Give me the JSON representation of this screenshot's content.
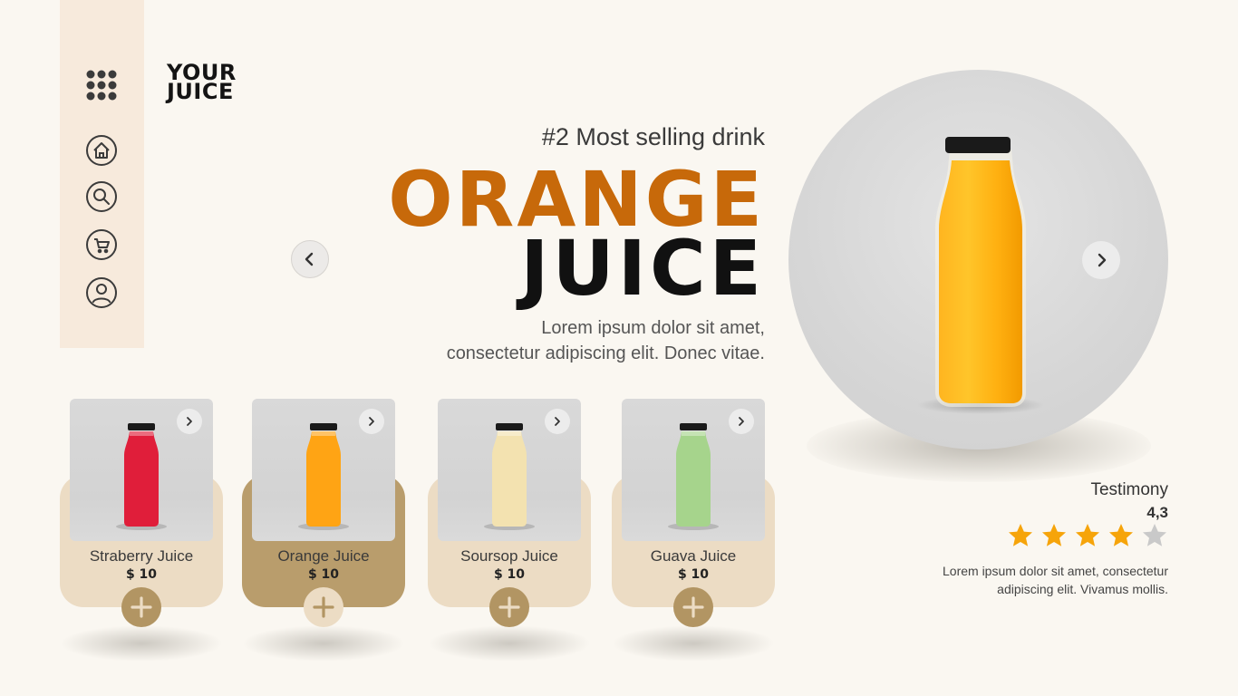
{
  "brand": {
    "line1": "YOUR",
    "line2": "JUICE"
  },
  "sidebar": {
    "items": [
      {
        "icon": "home-icon"
      },
      {
        "icon": "search-icon"
      },
      {
        "icon": "cart-icon"
      },
      {
        "icon": "user-icon"
      }
    ]
  },
  "hero": {
    "rank": "#2 Most selling drink",
    "title_line1": "ORANGE",
    "title_line2": "JUICE",
    "desc_line1": "Lorem ipsum dolor sit amet,",
    "desc_line2": "consectetur adipiscing elit. Donec vitae."
  },
  "testimony": {
    "label": "Testimony",
    "rating": "4,3",
    "stars_filled": 4,
    "stars_total": 5,
    "text_line1": "Lorem ipsum dolor sit amet, consectetur",
    "text_line2": "adipiscing elit. Vivamus mollis."
  },
  "products": [
    {
      "name": "Straberry Juice",
      "price": "$ 10",
      "juice_color": "#e01e3a"
    },
    {
      "name": "Orange Juice",
      "price": "$ 10",
      "juice_color": "#ffa414"
    },
    {
      "name": "Soursop Juice",
      "price": "$ 10",
      "juice_color": "#f3e2b0"
    },
    {
      "name": "Guava Juice",
      "price": "$ 10",
      "juice_color": "#a6d48c"
    }
  ],
  "colors": {
    "accent_orange": "#c7690a",
    "sidebar_bg": "#f7eadc",
    "card_bg": "#ecdcc4",
    "card_active_bg": "#b99d6c",
    "plus_bg": "#b29563",
    "star": "#f6a40a",
    "star_empty": "#c9c9c9"
  }
}
